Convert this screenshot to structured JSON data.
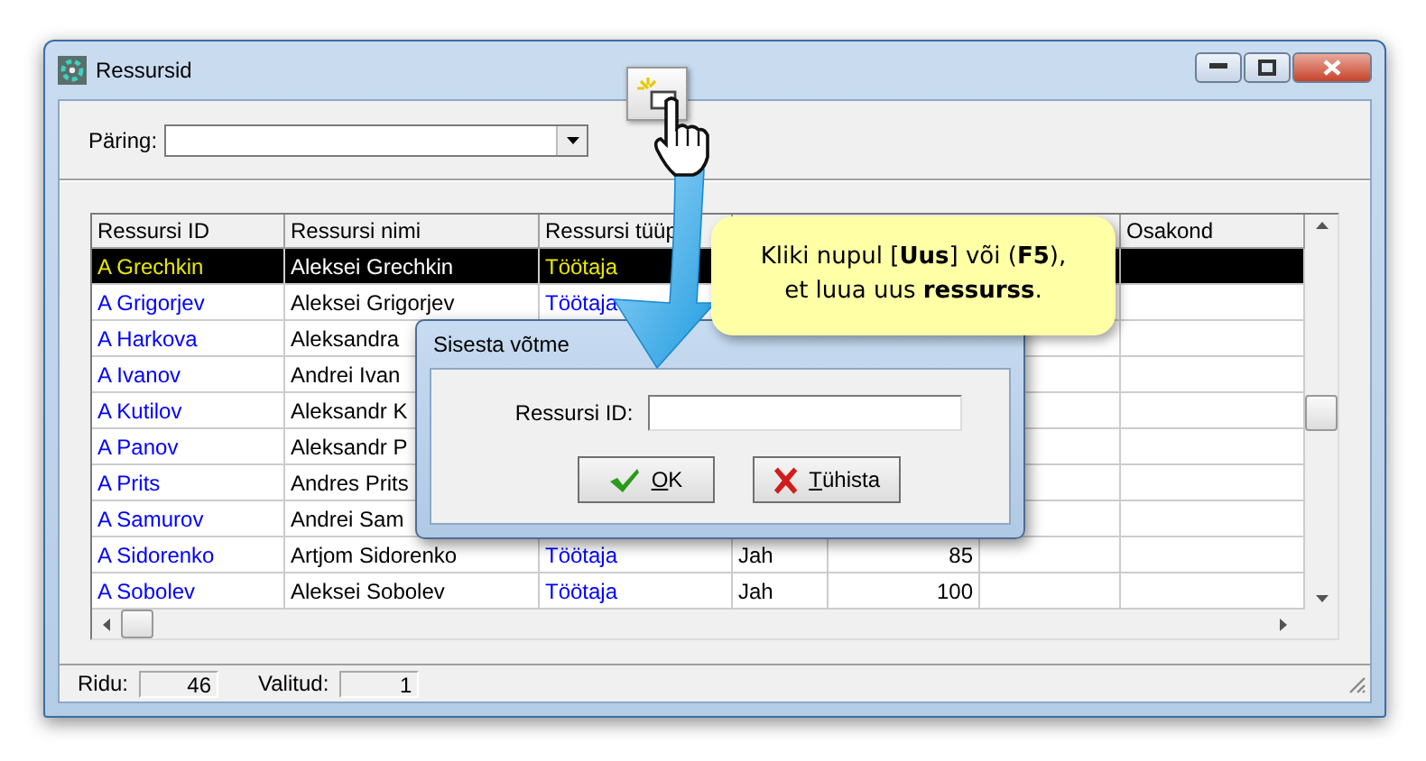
{
  "window": {
    "title": "Ressursid"
  },
  "query": {
    "label": "Päring:"
  },
  "table": {
    "columns": [
      {
        "label": "Ressursi ID"
      },
      {
        "label": "Ressursi nimi"
      },
      {
        "label": "Ressursi tüüp"
      },
      {
        "label": "Osakond"
      }
    ],
    "rows": [
      {
        "ressursi_id": "A Grechkin",
        "ressursi_nimi": "Aleksei Grechkin",
        "ressursi_tuup": "Töötaja",
        "selected": true
      },
      {
        "ressursi_id": "A Grigorjev",
        "ressursi_nimi": "Aleksei Grigorjev",
        "ressursi_tuup": "Töötaja",
        "selected": false
      },
      {
        "ressursi_id": "A Harkova",
        "ressursi_nimi": "Aleksandra",
        "selected": false
      },
      {
        "ressursi_id": "A Ivanov",
        "ressursi_nimi": "Andrei Ivan",
        "selected": false
      },
      {
        "ressursi_id": "A Kutilov",
        "ressursi_nimi": "Aleksandr K",
        "selected": false
      },
      {
        "ressursi_id": "A Panov",
        "ressursi_nimi": "Aleksandr P",
        "selected": false
      },
      {
        "ressursi_id": "A Prits",
        "ressursi_nimi": "Andres Prits",
        "selected": false
      },
      {
        "ressursi_id": "A Samurov",
        "ressursi_nimi": "Andrei Sam",
        "selected": false
      },
      {
        "ressursi_id": "A Sidorenko",
        "ressursi_nimi": "Artjom Sidorenko",
        "ressursi_tuup": "Töötaja",
        "column_4": "Jah",
        "column_5": "85",
        "selected": false
      },
      {
        "ressursi_id": "A Sobolev",
        "ressursi_nimi": "Aleksei Sobolev",
        "ressursi_tuup": "Töötaja",
        "column_4": "Jah",
        "column_5": "100",
        "selected": false
      }
    ]
  },
  "status_bar": [
    {
      "label": "Ridu:",
      "value": "46"
    },
    {
      "label": "Valitud:",
      "value": "1"
    }
  ],
  "dialog": {
    "title": "Sisesta võtme",
    "field_label": "Ressursi ID:",
    "buttons": [
      {
        "label": "OK",
        "kind": "ok"
      },
      {
        "label": "Tühista",
        "kind": "cancel"
      }
    ]
  },
  "callout": {
    "text": "Kliki nupul [**Uus**] või (**F5**),\net luua uus **ressurss**."
  }
}
